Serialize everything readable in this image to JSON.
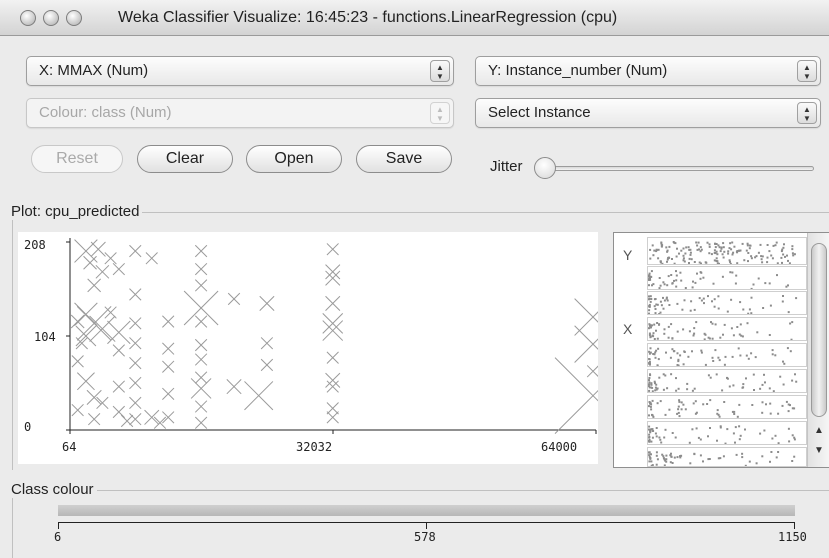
{
  "window": {
    "title": "Weka Classifier Visualize: 16:45:23 - functions.LinearRegression (cpu)"
  },
  "controls": {
    "x_axis": "X: MMAX (Num)",
    "y_axis": "Y: Instance_number (Num)",
    "colour": "Colour: class (Num)",
    "select_instance": "Select Instance",
    "reset": "Reset",
    "clear": "Clear",
    "open": "Open",
    "save": "Save",
    "jitter": "Jitter",
    "jitter_value": 0
  },
  "plot": {
    "title": "Plot: cpu_predicted",
    "y_ticks": [
      "208",
      "104",
      "0"
    ],
    "x_ticks": [
      "64",
      "32032",
      "64000"
    ]
  },
  "matrix": {
    "y_label": "Y",
    "x_label": "X"
  },
  "class_colour": {
    "title": "Class colour",
    "ticks": [
      "6",
      "578",
      "1150"
    ]
  },
  "chart_data": {
    "type": "scatter",
    "title": "Plot: cpu_predicted",
    "xlabel": "X: MMAX (Num)",
    "ylabel": "Y: Instance_number (Num)",
    "xlim": [
      64,
      64000
    ],
    "ylim": [
      0,
      208
    ],
    "x_ticks": [
      64,
      32032,
      64000
    ],
    "y_ticks": [
      0,
      104,
      208
    ],
    "grid": false,
    "colour_scale": {
      "label": "class",
      "min": 6,
      "mid": 578,
      "max": 1150
    },
    "points": [
      {
        "x": 2000,
        "y": 198,
        "s": 1.2
      },
      {
        "x": 3500,
        "y": 200,
        "s": 0.6
      },
      {
        "x": 2500,
        "y": 185,
        "s": 0.5
      },
      {
        "x": 4000,
        "y": 175,
        "s": 0.5
      },
      {
        "x": 5000,
        "y": 190,
        "s": 0.4
      },
      {
        "x": 3000,
        "y": 160,
        "s": 0.5
      },
      {
        "x": 6000,
        "y": 178,
        "s": 0.4
      },
      {
        "x": 8000,
        "y": 198,
        "s": 0.4
      },
      {
        "x": 8000,
        "y": 150,
        "s": 0.4
      },
      {
        "x": 8000,
        "y": 118,
        "s": 0.4
      },
      {
        "x": 8000,
        "y": 96,
        "s": 0.4
      },
      {
        "x": 8000,
        "y": 74,
        "s": 0.4
      },
      {
        "x": 8000,
        "y": 52,
        "s": 0.4
      },
      {
        "x": 8000,
        "y": 30,
        "s": 0.4
      },
      {
        "x": 8000,
        "y": 12,
        "s": 0.4
      },
      {
        "x": 2000,
        "y": 128,
        "s": 1.2
      },
      {
        "x": 3000,
        "y": 118,
        "s": 2.0
      },
      {
        "x": 4000,
        "y": 112,
        "s": 1.4
      },
      {
        "x": 2000,
        "y": 104,
        "s": 1.0
      },
      {
        "x": 1000,
        "y": 120,
        "s": 0.5
      },
      {
        "x": 1500,
        "y": 96,
        "s": 0.4
      },
      {
        "x": 6000,
        "y": 108,
        "s": 1.2
      },
      {
        "x": 5000,
        "y": 130,
        "s": 0.4
      },
      {
        "x": 6000,
        "y": 88,
        "s": 0.4
      },
      {
        "x": 1000,
        "y": 76,
        "s": 0.4
      },
      {
        "x": 2000,
        "y": 54,
        "s": 0.8
      },
      {
        "x": 3000,
        "y": 36,
        "s": 0.6
      },
      {
        "x": 4000,
        "y": 30,
        "s": 0.4
      },
      {
        "x": 1000,
        "y": 22,
        "s": 0.4
      },
      {
        "x": 3000,
        "y": 12,
        "s": 0.4
      },
      {
        "x": 6000,
        "y": 48,
        "s": 0.4
      },
      {
        "x": 6000,
        "y": 20,
        "s": 0.4
      },
      {
        "x": 7000,
        "y": 10,
        "s": 0.4
      },
      {
        "x": 10000,
        "y": 190,
        "s": 0.4
      },
      {
        "x": 12000,
        "y": 120,
        "s": 0.4
      },
      {
        "x": 12000,
        "y": 90,
        "s": 0.4
      },
      {
        "x": 12000,
        "y": 70,
        "s": 0.4
      },
      {
        "x": 12000,
        "y": 40,
        "s": 0.4
      },
      {
        "x": 12000,
        "y": 14,
        "s": 0.4
      },
      {
        "x": 10000,
        "y": 14,
        "s": 0.6
      },
      {
        "x": 11000,
        "y": 8,
        "s": 0.4
      },
      {
        "x": 16000,
        "y": 198,
        "s": 0.4
      },
      {
        "x": 16000,
        "y": 178,
        "s": 0.4
      },
      {
        "x": 16000,
        "y": 160,
        "s": 0.4
      },
      {
        "x": 16000,
        "y": 135,
        "s": 2.0
      },
      {
        "x": 16000,
        "y": 120,
        "s": 0.4
      },
      {
        "x": 16000,
        "y": 94,
        "s": 0.4
      },
      {
        "x": 16000,
        "y": 78,
        "s": 0.4
      },
      {
        "x": 16000,
        "y": 58,
        "s": 0.4
      },
      {
        "x": 16000,
        "y": 46,
        "s": 1.0
      },
      {
        "x": 16000,
        "y": 26,
        "s": 0.4
      },
      {
        "x": 16000,
        "y": 8,
        "s": 0.4
      },
      {
        "x": 20000,
        "y": 145,
        "s": 0.4
      },
      {
        "x": 20000,
        "y": 48,
        "s": 0.6
      },
      {
        "x": 23000,
        "y": 38,
        "s": 1.6
      },
      {
        "x": 24000,
        "y": 140,
        "s": 0.6
      },
      {
        "x": 24000,
        "y": 96,
        "s": 0.4
      },
      {
        "x": 24000,
        "y": 72,
        "s": 0.4
      },
      {
        "x": 32000,
        "y": 200,
        "s": 0.4
      },
      {
        "x": 32000,
        "y": 175,
        "s": 0.6
      },
      {
        "x": 32000,
        "y": 168,
        "s": 0.6
      },
      {
        "x": 32000,
        "y": 140,
        "s": 0.6
      },
      {
        "x": 32000,
        "y": 118,
        "s": 1.0
      },
      {
        "x": 32000,
        "y": 110,
        "s": 1.0
      },
      {
        "x": 32000,
        "y": 80,
        "s": 0.4
      },
      {
        "x": 32000,
        "y": 55,
        "s": 0.6
      },
      {
        "x": 32000,
        "y": 48,
        "s": 0.4
      },
      {
        "x": 32000,
        "y": 24,
        "s": 0.4
      },
      {
        "x": 32000,
        "y": 14,
        "s": 0.4
      },
      {
        "x": 64000,
        "y": 125,
        "s": 2.2
      },
      {
        "x": 64000,
        "y": 95,
        "s": 2.2
      },
      {
        "x": 64000,
        "y": 38,
        "s": 5.0
      },
      {
        "x": 64000,
        "y": 65,
        "s": 0.4
      }
    ]
  }
}
